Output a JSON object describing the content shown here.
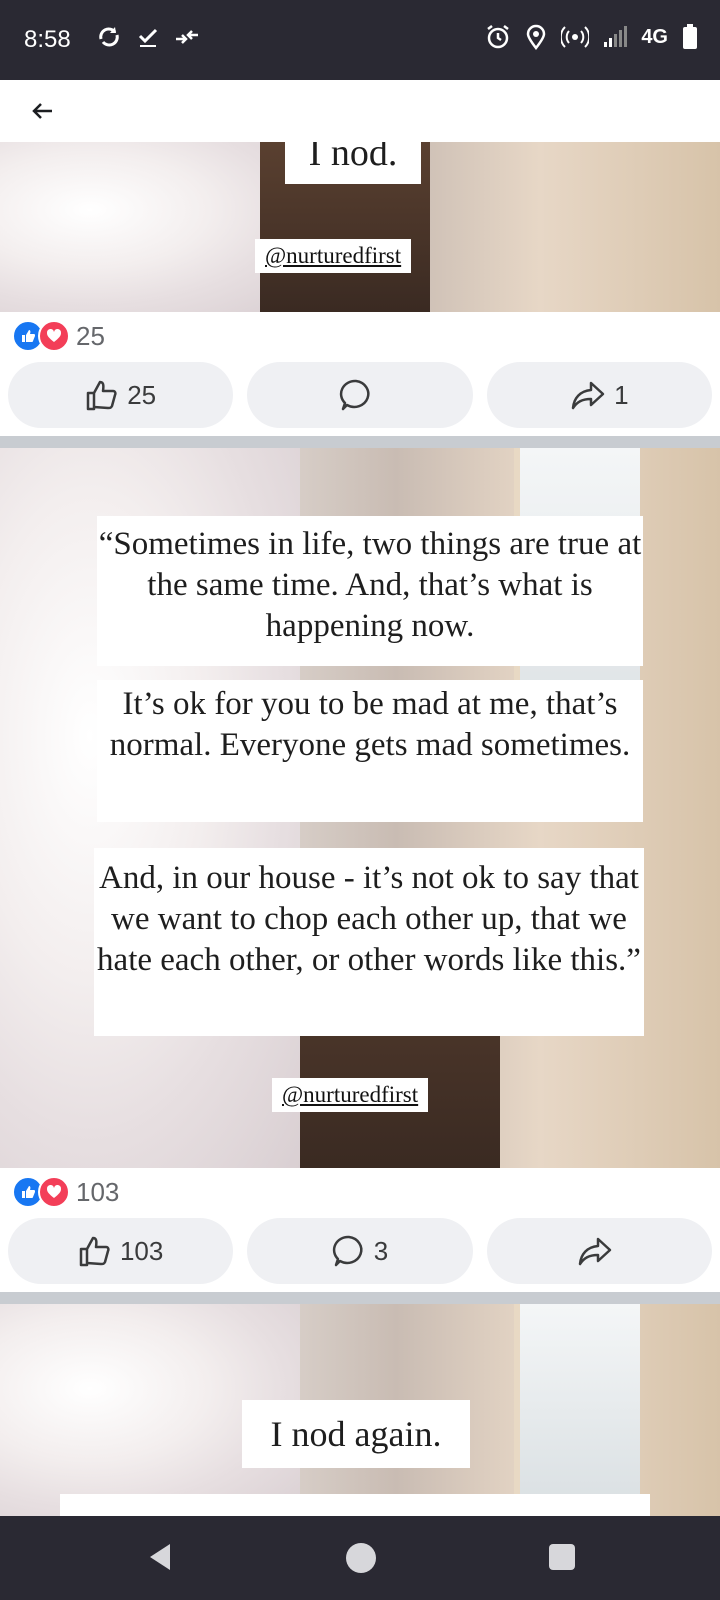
{
  "status_bar": {
    "time": "8:58",
    "left_icons": [
      "sync-icon",
      "check-icon",
      "transfer-arrows-icon"
    ],
    "right_icons": [
      "alarm-icon",
      "location-icon",
      "hotspot-icon",
      "signal-icon",
      "battery-icon"
    ],
    "network": "4G"
  },
  "app_bar": {
    "back_icon": "arrow-left-icon"
  },
  "posts": [
    {
      "captions": [
        "I nod."
      ],
      "handle": "@nurturedfirst",
      "reaction_count": "25",
      "like_label": "25",
      "comment_label": "",
      "share_label": "1"
    },
    {
      "captions": [
        "“Sometimes in life, two things are true at the same time. And, that’s what is happening now.",
        "It’s ok for you to be mad at me, that’s normal. Everyone gets mad sometimes.",
        "And, in our house - it’s not ok to say that we want to chop each other up, that we hate each other, or other words like this.”"
      ],
      "handle": "@nurturedfirst",
      "reaction_count": "103",
      "like_label": "103",
      "comment_label": "3",
      "share_label": ""
    },
    {
      "captions": [
        "I nod again."
      ]
    }
  ],
  "colors": {
    "like_blue": "#1877f2",
    "love_red": "#f33e58",
    "bar_dark": "#2a2933"
  }
}
